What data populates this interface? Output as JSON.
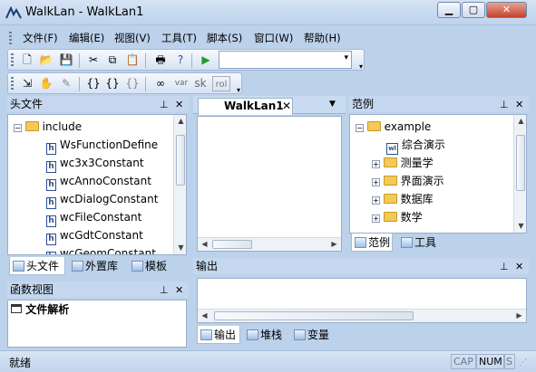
{
  "window": {
    "title": "WalkLan - WalkLan1",
    "min": "0",
    "max": "1",
    "close": "r"
  },
  "menu": [
    "文件(F)",
    "编辑(E)",
    "视图(V)",
    "工具(T)",
    "脚本(S)",
    "窗口(W)",
    "帮助(H)"
  ],
  "toolbar1": {
    "icons": [
      "new-file-icon",
      "open-folder-icon",
      "save-icon",
      "cut-icon",
      "copy-icon",
      "paste-icon",
      "print-icon",
      "help-icon",
      "run-icon"
    ],
    "combo_value": ""
  },
  "toolbar2": {
    "icons": [
      "format-icon",
      "hand-icon",
      "edit-icon",
      "brace-icon",
      "brace2-icon",
      "brace3-icon",
      "link-icon"
    ],
    "labels": [
      "var",
      "sk",
      "rol"
    ]
  },
  "left_panel": {
    "title": "头文件",
    "tree": {
      "root": "include",
      "items": [
        "WsFunctionDefine",
        "wc3x3Constant",
        "wcAnnoConstant",
        "wcDialogConstant",
        "wcFileConstant",
        "wcGdtConstant",
        "wcGeomConstant"
      ]
    },
    "tabs": [
      "头文件",
      "外置库",
      "模板"
    ]
  },
  "func_panel": {
    "title": "函数视图",
    "item": "文件解析"
  },
  "editor": {
    "tab": "WalkLan1"
  },
  "sample_panel": {
    "title": "范例",
    "tree": {
      "root": "example",
      "items": [
        "综合演示",
        "测量学",
        "界面演示",
        "数据库",
        "数学"
      ]
    },
    "tabs": [
      "范例",
      "工具"
    ]
  },
  "output_panel": {
    "title": "输出",
    "tabs": [
      "输出",
      "堆栈",
      "变量"
    ]
  },
  "status": {
    "text": "就绪",
    "cap": "CAP",
    "num": "NUM",
    "scrl": "S"
  }
}
